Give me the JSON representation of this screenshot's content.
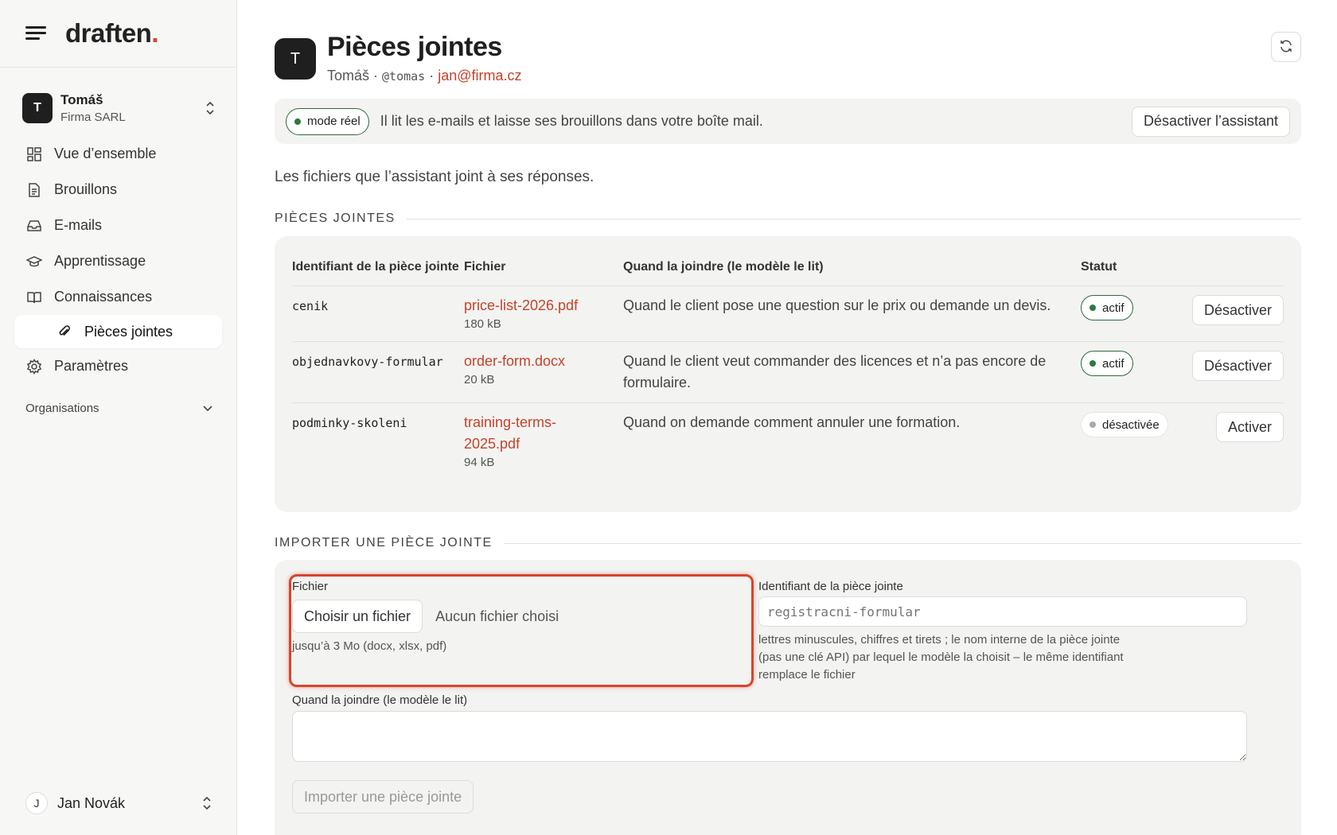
{
  "brand": {
    "name": "draften",
    "dot": "."
  },
  "org": {
    "initial": "T",
    "name": "Tomáš",
    "company": "Firma SARL"
  },
  "nav": {
    "items": [
      {
        "label": "Vue d’ensemble",
        "icon": "dashboard-icon"
      },
      {
        "label": "Brouillons",
        "icon": "document-icon"
      },
      {
        "label": "E-mails",
        "icon": "inbox-icon"
      },
      {
        "label": "Apprentissage",
        "icon": "graduation-cap-icon"
      },
      {
        "label": "Connaissances",
        "icon": "book-icon"
      }
    ],
    "sub_item": {
      "label": "Pièces jointes",
      "icon": "paperclip-icon"
    },
    "settings": {
      "label": "Paramètres",
      "icon": "gear-icon"
    },
    "section": "Organisations"
  },
  "user": {
    "initial": "J",
    "name": "Jan Novák"
  },
  "header": {
    "initial": "T",
    "title": "Pièces jointes",
    "name": "Tomáš",
    "handle": "@tomas",
    "email": "jan@firma.cz"
  },
  "banner": {
    "mode": "mode réel",
    "text": "Il lit les e-mails et laisse ses brouillons dans votre boîte mail.",
    "button": "Désactiver l’assistant"
  },
  "intro": "Les fichiers que l’assistant joint à ses réponses.",
  "attachments": {
    "section_title": "PIÈCES JOINTES",
    "columns": [
      "Identifiant de la pièce jointe",
      "Fichier",
      "Quand la joindre (le modèle le lit)",
      "Statut"
    ],
    "rows": [
      {
        "id": "cenik",
        "file": "price-list-2026.pdf",
        "size": "180 kB",
        "when": "Quand le client pose une question sur le prix ou demande un devis.",
        "status": "actif",
        "action": "Désactiver"
      },
      {
        "id": "objednavkovy-formular",
        "file": "order-form.docx",
        "size": "20 kB",
        "when": "Quand le client veut commander des licences et n’a pas encore de formulaire.",
        "status": "actif",
        "action": "Désactiver"
      },
      {
        "id": "podminky-skoleni",
        "file": "training-terms-2025.pdf",
        "size": "94 kB",
        "when": "Quand on demande comment annuler une formation.",
        "status": "désactivée",
        "action": "Activer"
      }
    ]
  },
  "upload": {
    "section_title": "IMPORTER UNE PIÈCE JOINTE",
    "file_label": "Fichier",
    "choose_button": "Choisir un fichier",
    "no_file": "Aucun fichier choisi",
    "file_hint": "jusqu’à 3 Mo (docx, xlsx, pdf)",
    "id_label": "Identifiant de la pièce jointe",
    "id_placeholder": "registracni-formular",
    "id_hint_1": "lettres minuscules, chiffres et tirets ; le nom interne de la pièce jointe",
    "id_hint_2": "(pas une clé API) par lequel le modèle la choisit – le même identifiant",
    "id_hint_3": "remplace le fichier",
    "when_label": "Quand la joindre (le modèle le lit)",
    "submit": "Importer une pièce jointe"
  },
  "colors": {
    "accent": "#c4432a",
    "active_green": "#2b7a3f",
    "highlight": "#d9442b"
  }
}
